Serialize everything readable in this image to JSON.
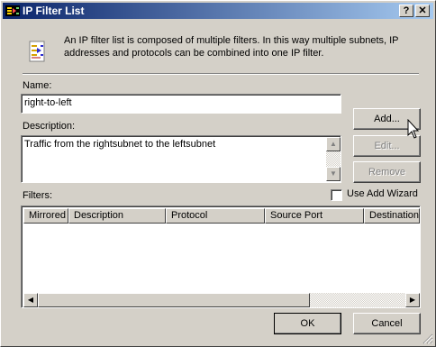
{
  "window": {
    "title": "IP Filter List",
    "help_button": "?",
    "close_button": "✕"
  },
  "intro": {
    "text": "An IP filter list is composed of multiple filters. In this way multiple subnets, IP addresses and protocols can be combined into one IP filter."
  },
  "name": {
    "label": "Name:",
    "value": "right-to-left"
  },
  "description": {
    "label": "Description:",
    "value": "Traffic from the rightsubnet to the leftsubnet"
  },
  "buttons": {
    "add": "Add...",
    "edit": "Edit...",
    "remove": "Remove",
    "ok": "OK",
    "cancel": "Cancel"
  },
  "wizard": {
    "label": "Use Add Wizard",
    "checked": false
  },
  "filters": {
    "label": "Filters:",
    "columns": [
      "Mirrored",
      "Description",
      "Protocol",
      "Source Port",
      "Destination"
    ],
    "rows": []
  },
  "icons": {
    "app": "filter-list-icon",
    "intro": "filter-list-icon",
    "cursor": "mouse-pointer-icon"
  }
}
